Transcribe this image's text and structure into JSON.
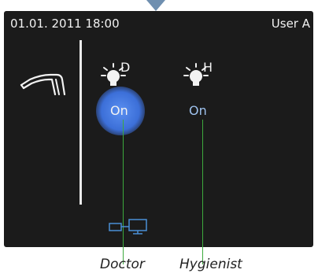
{
  "status_bar": {
    "datetime": "01.01. 2011 18:00",
    "user": "User A"
  },
  "lights": {
    "doctor": {
      "letter": "D",
      "state": "On",
      "active": true
    },
    "hygienist": {
      "letter": "H",
      "state": "On",
      "active": false
    }
  },
  "captions": {
    "doctor": "Doctor",
    "hygienist": "Hygienist"
  },
  "icons": {
    "handpiece": "handpiece-icon",
    "network": "network-icon",
    "bulb": "light-bulb-icon"
  },
  "colors": {
    "screen_bg": "#1b1b1b",
    "active_glow": "#3c6fd8",
    "callout_line": "#3daa3d",
    "pointer": "#6f8fb0"
  }
}
